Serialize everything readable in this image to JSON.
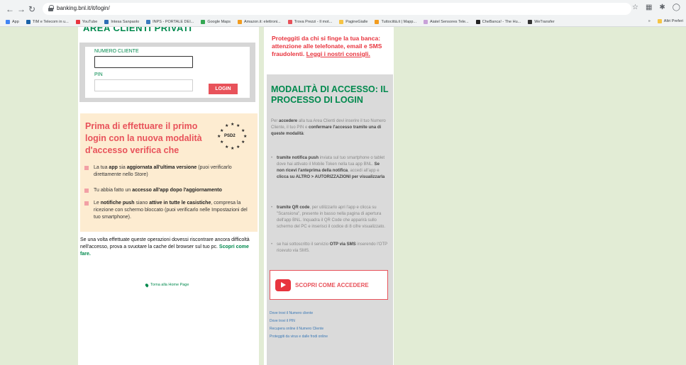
{
  "browser": {
    "url": "banking.bnl.it/it/login/",
    "bookmarks": [
      {
        "label": "App",
        "color": "#4285f4"
      },
      {
        "label": "TIM e Telecom in u...",
        "color": "#1a62a8"
      },
      {
        "label": "YouTube",
        "color": "#e8343e"
      },
      {
        "label": "Intesa Sanpaolo",
        "color": "#2f6db5"
      },
      {
        "label": "INPS - PORTALE DEI...",
        "color": "#3b7bbf"
      },
      {
        "label": "Google Maps",
        "color": "#34a853"
      },
      {
        "label": "Amazon.it: elettroni...",
        "color": "#f29c1f"
      },
      {
        "label": "Trova Prezzi - Il mot...",
        "color": "#e8525a"
      },
      {
        "label": "PagineGialle",
        "color": "#f6c445"
      },
      {
        "label": "Tuttocittà.it | Mapp...",
        "color": "#f29c1f"
      },
      {
        "label": "Aiatel Sensores Tele...",
        "color": "#c8a2d8"
      },
      {
        "label": "CheBanca! - The Hu...",
        "color": "#222222"
      },
      {
        "label": "WeTransfer",
        "color": "#333333"
      }
    ],
    "bookmarks_more": "»",
    "other_bookmarks": "Altri Preferi"
  },
  "left": {
    "area_title": "AREA CLIENTI PRIVATI",
    "client_label": "NUMERO CLIENTE",
    "pin_label": "PIN",
    "login_button": "LOGIN",
    "info_title": "Prima di effettuare il primo login con la nuova modalità d'accesso verifica che",
    "psd2_label": "PSD2",
    "bullets": [
      {
        "pre": "La tua ",
        "b1": "app",
        "mid": " sia ",
        "b2": "aggiornata all'ultima versione",
        "post": " (puoi verificarlo direttamente nello Store)"
      },
      {
        "pre": "Tu abbia fatto un ",
        "b1": "accesso all'app dopo l'aggiornamento",
        "mid": "",
        "b2": "",
        "post": ""
      },
      {
        "pre": "Le ",
        "b1": "notifiche push",
        "mid": " siano ",
        "b2": "attive in tutte le casistiche",
        "post": ", compresa la ricezione con schermo bloccato (puoi verificarlo nelle Impostazioni del tuo smartphone)."
      }
    ],
    "help_text": "Se una volta effettuate queste operazioni dovessi riscontrare ancora difficoltà nell'accesso, prova a svuotare la cache del browser sul tuo pc.",
    "help_link": "Scopri come fare.",
    "home_link": "Torna alla Home Page"
  },
  "middle": {
    "warning_text": "Proteggiti da chi si finge la tua banca: attenzione alle telefonate, email e SMS fraudolenti.",
    "warning_link": "Leggi i nostri consigli.",
    "mode_title": "MODALITÀ DI ACCESSO: IL PROCESSO DI LOGIN",
    "intro": {
      "pre": "Per ",
      "b1": "accedere",
      "mid": " alla tua Area Clienti devi inserire il tuo Numero Cliente, il tuo PIN e ",
      "b2": "confermare l'accesso tramite una di queste modalità",
      "post": ":"
    },
    "items": [
      {
        "b1": "tramite notifica push",
        "text": " inviata sul tuo smartphone o tablet dove hai attivato il Mobile Token nella tua app BNL. ",
        "b2": "Se non ricevi l'anteprima della notifica",
        "text2": ", accedi all'app e ",
        "b3": "clicca su ALTRO > AUTORIZZAZIONI per visualizzarla"
      },
      {
        "b1": "tramite QR code",
        "text": ", per utilizzarlo apri l'app e clicca su \"Scansiona\", presente in basso nella pagina di apertura dell'app BNL. Inquadra il QR Code che apparirà sullo schermo del PC e inserisci il codice di 8 cifre visualizzato.",
        "b2": "",
        "text2": "",
        "b3": ""
      },
      {
        "b1": "",
        "text": "se hai sottoscritto il servizio ",
        "b2": "OTP via SMS",
        "text2": " inserendo l'OTP ricevuto via SMS.",
        "b3": ""
      }
    ],
    "discover_button": "SCOPRI COME ACCEDERE",
    "links": [
      "Dove trovi il Numero cliente",
      "Dove trovi il PIN",
      "Recupera online il Numero Cliente",
      "Proteggiti da virus e dalle frodi online"
    ]
  }
}
